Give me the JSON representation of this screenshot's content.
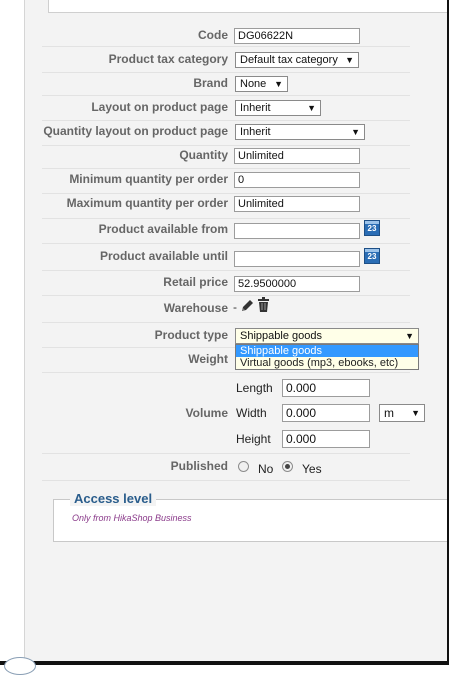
{
  "form": {
    "code": {
      "label": "Code",
      "value": "DG06622N"
    },
    "tax": {
      "label": "Product tax category",
      "value": "Default tax category"
    },
    "brand": {
      "label": "Brand",
      "value": "None"
    },
    "layout": {
      "label": "Layout on product page",
      "value": "Inherit"
    },
    "qty_layout": {
      "label": "Quantity layout on product page",
      "value": "Inherit"
    },
    "quantity": {
      "label": "Quantity",
      "value": "Unlimited"
    },
    "min_qty": {
      "label": "Minimum quantity per order",
      "value": "0"
    },
    "max_qty": {
      "label": "Maximum quantity per order",
      "value": "Unlimited"
    },
    "avail_from": {
      "label": "Product available from",
      "value": "",
      "calendar_icon_text": "23"
    },
    "avail_until": {
      "label": "Product available until",
      "value": "",
      "calendar_icon_text": "23"
    },
    "retail_price": {
      "label": "Retail price",
      "value": "52.9500000"
    },
    "warehouse": {
      "label": "Warehouse",
      "value": "-",
      "icons": [
        "edit-icon",
        "trash-icon"
      ]
    },
    "product_type": {
      "label": "Product type",
      "value": "Shippable goods",
      "options": [
        "Shippable goods",
        "Virtual goods (mp3, ebooks, etc)"
      ],
      "open": true
    },
    "weight": {
      "label": "Weight"
    },
    "volume": {
      "label": "Volume",
      "length": {
        "label": "Length",
        "value": "0.000"
      },
      "width": {
        "label": "Width",
        "value": "0.000"
      },
      "height": {
        "label": "Height",
        "value": "0.000"
      },
      "unit": "m"
    },
    "published": {
      "label": "Published",
      "no": "No",
      "yes": "Yes",
      "selected": "Yes"
    }
  },
  "access": {
    "title": "Access level",
    "note": "Only from HikaShop Business"
  },
  "colors": {
    "dropdown_highlight": "#3399ff",
    "legend": "#2a5d8c",
    "note": "#8a3a8a"
  }
}
